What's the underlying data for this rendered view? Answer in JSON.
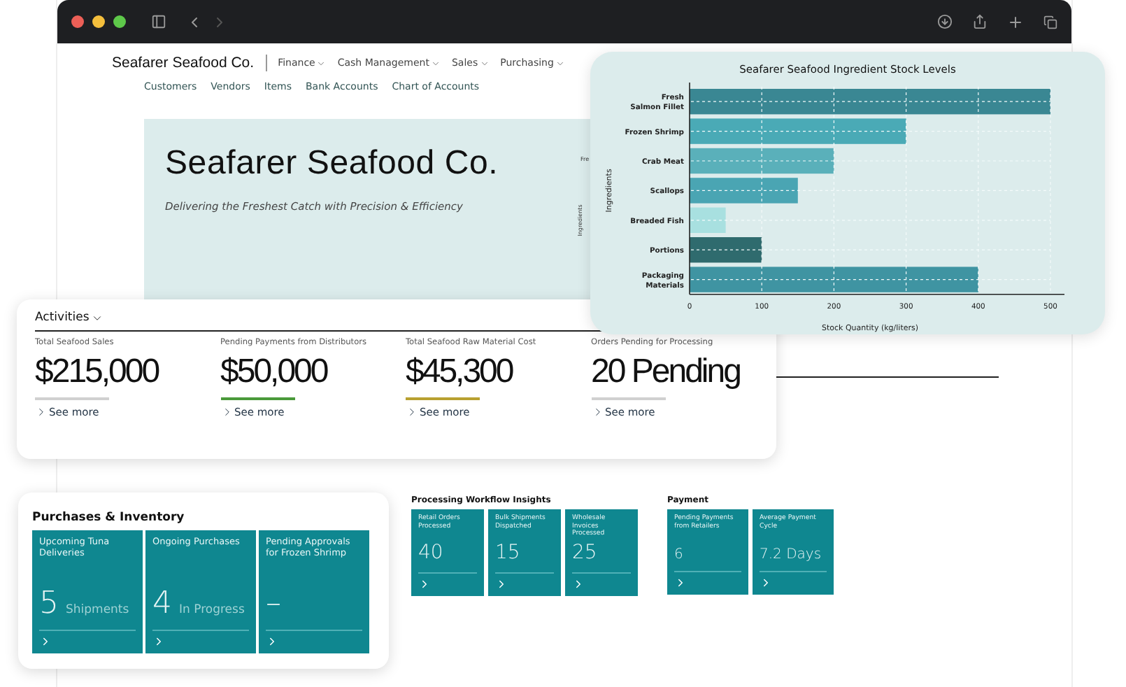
{
  "nav": {
    "brand": "Seafarer Seafood Co.",
    "menus": [
      "Finance",
      "Cash Management",
      "Sales",
      "Purchasing"
    ],
    "links": [
      "Customers",
      "Vendors",
      "Items",
      "Bank Accounts",
      "Chart of Accounts"
    ]
  },
  "hero": {
    "title": "Seafarer Seafood Co.",
    "subtitle": "Delivering the Freshest Catch with Precision & Efficiency",
    "chart_fragment": {
      "label": "Fre",
      "axis": "Ingredients"
    }
  },
  "stock_chart": {
    "chart_data": {
      "type": "bar",
      "orientation": "horizontal",
      "title": "Seafarer Seafood Ingredient Stock Levels",
      "xlabel": "Stock Quantity (kg/liters)",
      "ylabel": "Ingredients",
      "categories": [
        "Fresh Salmon Fillet",
        "Frozen Shrimp",
        "Crab Meat",
        "Scallops",
        "Breaded Fish",
        "Portions",
        "Packaging Materials"
      ],
      "xlim": [
        0,
        500
      ],
      "xticks": [
        0,
        100,
        200,
        300,
        400,
        500
      ],
      "grid": true,
      "series": [
        {
          "colors": [
            "#3a8793",
            "#4aaab6",
            "#5ab0ba",
            "#4aa5b3",
            "#a8e0e0",
            "#2f6b6e",
            "#3f94a2"
          ],
          "values": [
            500,
            300,
            200,
            150,
            50,
            100,
            400
          ]
        }
      ]
    }
  },
  "activities": {
    "title": "Activities",
    "items": [
      {
        "label": "Total Seafood Sales",
        "value": "$215,000",
        "link": "See more",
        "color": "#d0d0d0"
      },
      {
        "label": "Pending Payments from Distributors",
        "value": "$50,000",
        "link": "See more",
        "color": "#4a9a3a"
      },
      {
        "label": "Total Seafood Raw Material Cost",
        "value": "$45,300",
        "link": "See more",
        "color": "#b8a030"
      },
      {
        "label": "Orders Pending for Processing",
        "value": "20 Pending",
        "link": "See more",
        "color": "#d0d0d0"
      }
    ]
  },
  "purchases": {
    "title": "Purchases & Inventory",
    "tiles": [
      {
        "label": "Upcoming Tuna Deliveries",
        "value": "5",
        "unit": "Shipments"
      },
      {
        "label": "Ongoing Purchases",
        "value": "4",
        "unit": "In Progress"
      },
      {
        "label": "Pending Approvals for Frozen Shrimp",
        "value": "–"
      }
    ]
  },
  "processing": {
    "title": "Processing Workflow Insights",
    "tiles": [
      {
        "label": "Retail Orders Processed",
        "value": "40"
      },
      {
        "label": "Bulk Shipments Dispatched",
        "value": "15"
      },
      {
        "label": "Wholesale Invoices Processed",
        "value": "25"
      }
    ]
  },
  "payment": {
    "title": "Payment",
    "tiles": [
      {
        "label": "Pending Payments from Retailers",
        "value": "6"
      },
      {
        "label": "Average Payment Cycle",
        "value": "7.2 Days"
      }
    ]
  }
}
